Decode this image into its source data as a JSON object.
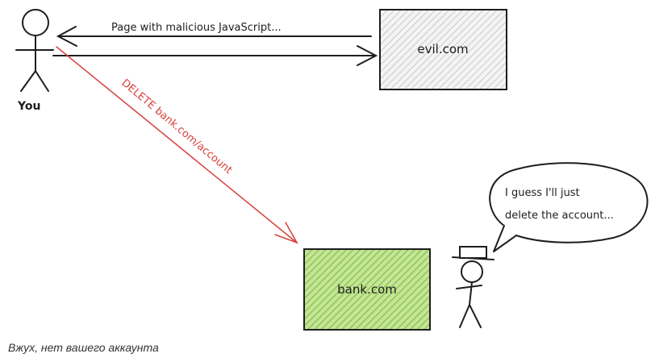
{
  "diagram": {
    "you_label": "You",
    "arrow_top_label": "Page with malicious JavaScript...",
    "evil_label": "evil.com",
    "red_arrow_label": "DELETE bank.com/account",
    "bank_label": "bank.com",
    "speech_line1": "I guess I'll just",
    "speech_line2": "delete the account..."
  },
  "caption": "Вжух, нет вашего аккаунта",
  "colors": {
    "stroke": "#1e1e1e",
    "red": "#d9403a",
    "evil_fill": "#e9e9e9",
    "bank_fill": "#9ccf4f"
  }
}
